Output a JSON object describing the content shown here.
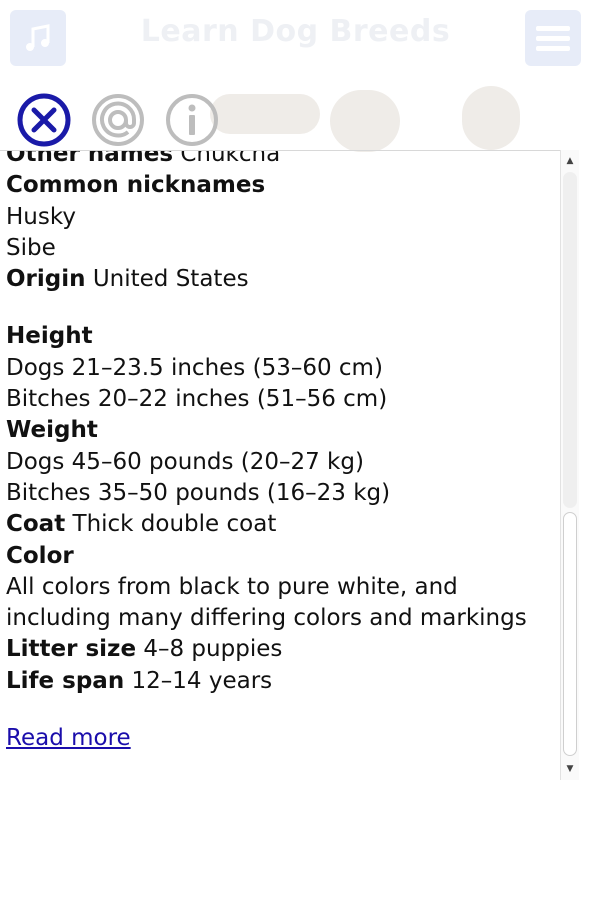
{
  "header": {
    "title": "Learn Dog Breeds",
    "music_icon": "music-note-icon",
    "menu_icon": "hamburger-menu-icon"
  },
  "actions": {
    "close_icon": "close-circle-icon",
    "at_icon": "at-sign-icon",
    "info_icon": "info-icon",
    "accent_color": "#1a1aa8",
    "muted_color": "#b8b8b8"
  },
  "breed_info": {
    "other_names_label": "Other names",
    "other_names_value": "Chukcha",
    "common_nicknames_label": "Common nicknames",
    "nicknames": [
      "Husky",
      "Sibe"
    ],
    "origin_label": "Origin",
    "origin_value": "United States",
    "height_label": "Height",
    "height_dogs": "Dogs 21–23.5 inches (53–60 cm)",
    "height_bitches": "Bitches 20–22 inches (51–56 cm)",
    "weight_label": "Weight",
    "weight_dogs": "Dogs 45–60 pounds (20–27 kg)",
    "weight_bitches": "Bitches 35–50 pounds (16–23 kg)",
    "coat_label": "Coat",
    "coat_value": "Thick double coat",
    "color_label": "Color",
    "color_value": "All colors from black to pure white, and including many differing colors and markings",
    "litter_size_label": "Litter size",
    "litter_size_value": "4–8 puppies",
    "life_span_label": "Life span",
    "life_span_value": "12–14 years",
    "read_more": "Read more"
  }
}
